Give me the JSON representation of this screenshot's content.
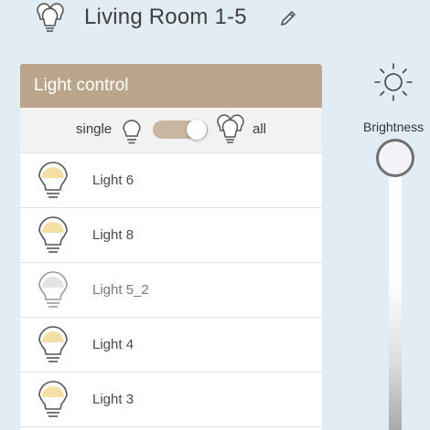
{
  "header": {
    "title": "Living Room 1-5",
    "room_icon": "multi-bulb-icon",
    "edit_icon": "pencil-icon"
  },
  "panel": {
    "title": "Light control",
    "mode": {
      "single_label": "single",
      "all_label": "all",
      "toggle_state": "all"
    },
    "lights": [
      {
        "label": "Light 6",
        "state": "on"
      },
      {
        "label": "Light 8",
        "state": "on"
      },
      {
        "label": "Light 5_2",
        "state": "off"
      },
      {
        "label": "Light 4",
        "state": "on"
      },
      {
        "label": "Light 3",
        "state": "on"
      }
    ]
  },
  "brightness": {
    "label": "Brightness",
    "icon": "sun-icon",
    "level": 1.0
  },
  "colors": {
    "background": "#e2ecf4",
    "panel_header": "#bca68b",
    "toggle_track": "#c9b6a1",
    "bulb_on": "#f6dfa5",
    "bulb_off": "#e4e4e4"
  }
}
